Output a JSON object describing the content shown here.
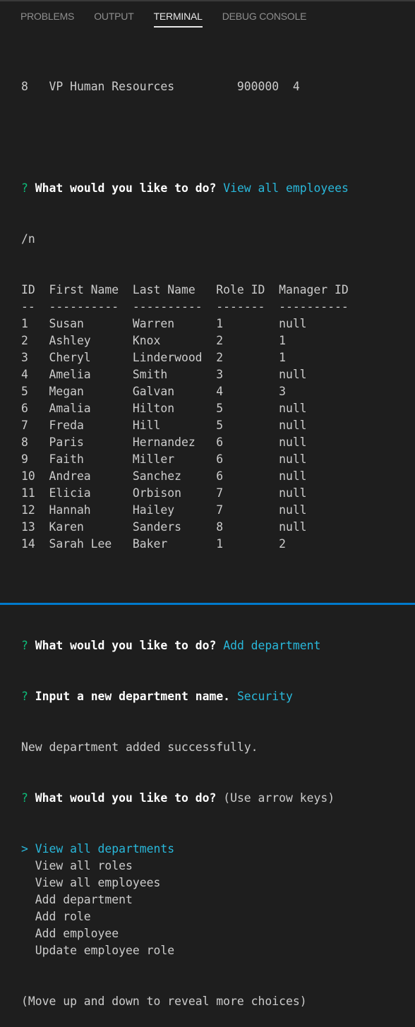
{
  "panel": {
    "tabs": [
      {
        "label": "PROBLEMS",
        "active": false
      },
      {
        "label": "OUTPUT",
        "active": false
      },
      {
        "label": "TERMINAL",
        "active": true
      },
      {
        "label": "DEBUG CONSOLE",
        "active": false
      }
    ]
  },
  "terminal": {
    "role_row": {
      "id": "8",
      "title": "VP Human Resources",
      "salary": "900000",
      "department": "4"
    },
    "prompt1": {
      "mark": "?",
      "question": "What would you like to do?",
      "answer": "View all employees"
    },
    "newline_text": "/n",
    "table": {
      "headers": [
        "ID",
        "First Name",
        "Last Name",
        "Role ID",
        "Manager ID"
      ],
      "separators": [
        "--",
        "----------",
        "----------",
        "-------",
        "----------"
      ],
      "rows": [
        [
          "1",
          "Susan",
          "Warren",
          "1",
          "null"
        ],
        [
          "2",
          "Ashley",
          "Knox",
          "2",
          "1"
        ],
        [
          "3",
          "Cheryl",
          "Linderwood",
          "2",
          "1"
        ],
        [
          "4",
          "Amelia",
          "Smith",
          "3",
          "null"
        ],
        [
          "5",
          "Megan",
          "Galvan",
          "4",
          "3"
        ],
        [
          "6",
          "Amalia",
          "Hilton",
          "5",
          "null"
        ],
        [
          "7",
          "Freda",
          "Hill",
          "5",
          "null"
        ],
        [
          "8",
          "Paris",
          "Hernandez",
          "6",
          "null"
        ],
        [
          "9",
          "Faith",
          "Miller",
          "6",
          "null"
        ],
        [
          "10",
          "Andrea",
          "Sanchez",
          "6",
          "null"
        ],
        [
          "11",
          "Elicia",
          "Orbison",
          "7",
          "null"
        ],
        [
          "12",
          "Hannah",
          "Hailey",
          "7",
          "null"
        ],
        [
          "13",
          "Karen",
          "Sanders",
          "8",
          "null"
        ],
        [
          "14",
          "Sarah Lee",
          "Baker",
          "1",
          "2"
        ]
      ]
    },
    "prompt2": {
      "mark": "?",
      "question": "What would you like to do?",
      "answer": "Add department"
    },
    "prompt3": {
      "mark": "?",
      "question": "Input a new department name.",
      "answer": "Security"
    },
    "success_message": "New department added successfully.",
    "prompt4": {
      "mark": "?",
      "question": "What would you like to do?",
      "hint": "(Use arrow keys)"
    },
    "menu": {
      "pointer": ">",
      "options": [
        "View all departments",
        "View all roles",
        "View all employees",
        "Add department",
        "Add role",
        "Add employee",
        "Update employee role"
      ],
      "selected_index": 0,
      "footer": "(Move up and down to reveal more choices)"
    }
  },
  "colors": {
    "background": "#1e1e1e",
    "text": "#cccccc",
    "prompt_mark": "#0dbc79",
    "answer": "#29b8db",
    "status_bar": "#007acc"
  }
}
